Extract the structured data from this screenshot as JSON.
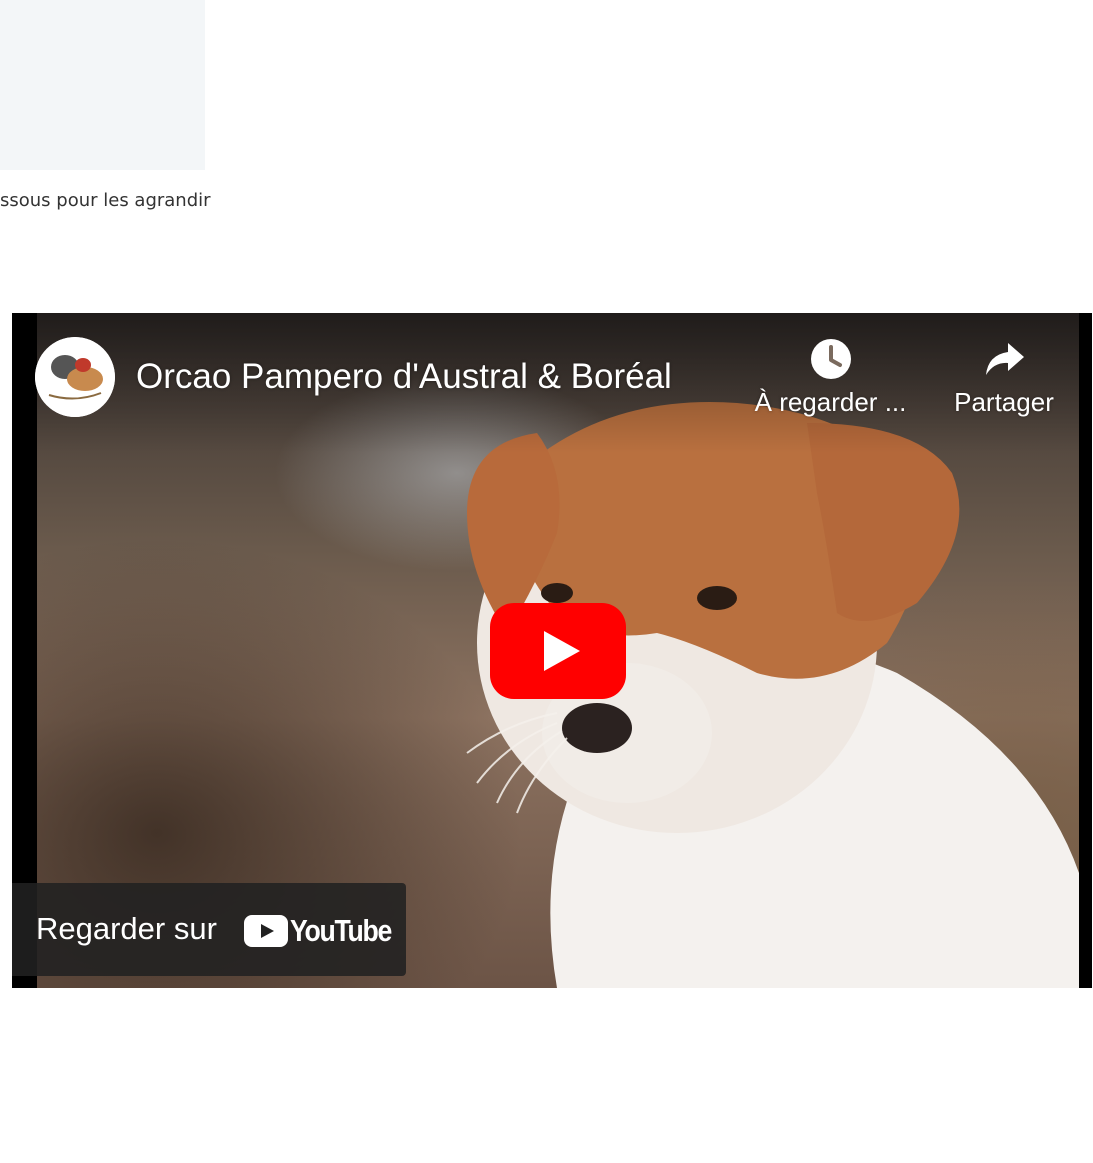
{
  "caption": "ssous pour les agrandir",
  "video": {
    "title": "Orcao Pampero d'Austral & Boréal",
    "channel_avatar": "channel-logo",
    "actions": {
      "watch_later": {
        "label": "À regarder ...",
        "icon": "clock-icon"
      },
      "share": {
        "label": "Partager",
        "icon": "share-arrow-icon"
      }
    },
    "play_button": {
      "icon": "play-icon",
      "color": "#ff0000"
    },
    "watch_on": {
      "text": "Regarder sur",
      "brand": "YouTube"
    }
  },
  "colors": {
    "youtube_red": "#ff0000",
    "placeholder_bg": "#f3f6f8",
    "overlay_bg": "#212121"
  }
}
